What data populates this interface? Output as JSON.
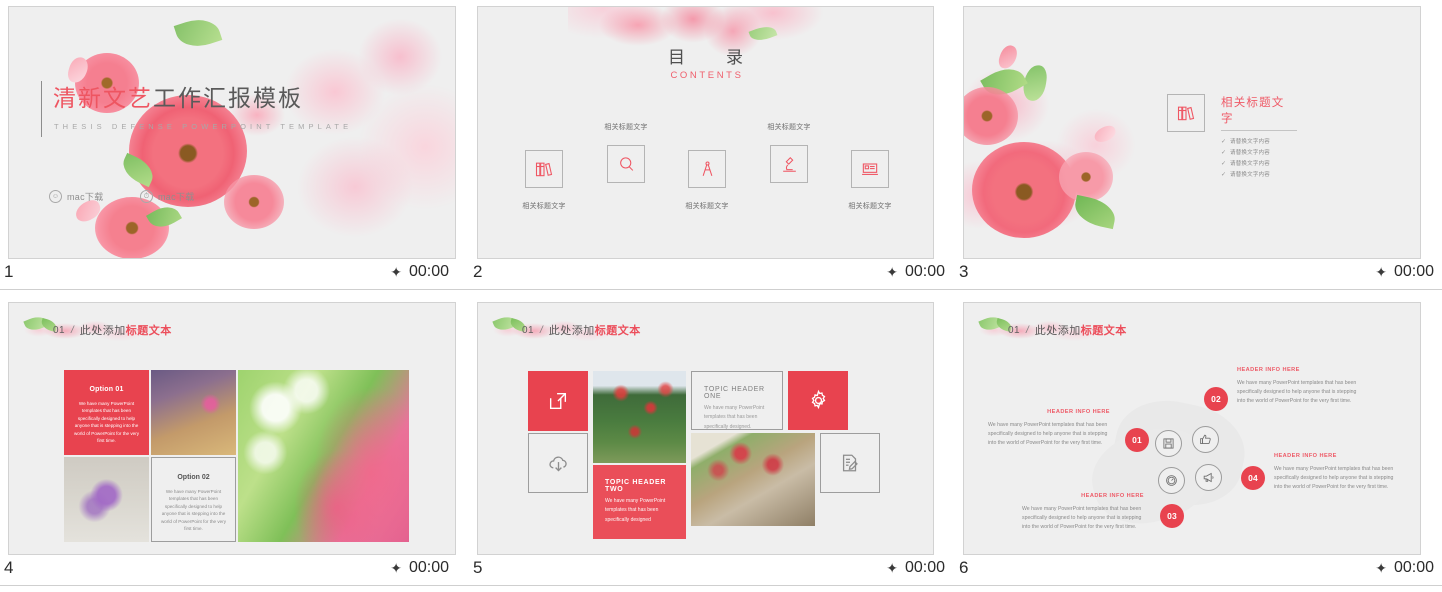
{
  "accent_red": "#e8434f",
  "title_red": "#ee5561",
  "slide_bg": "#efefef",
  "slides": [
    {
      "number": "1",
      "time": "00:00",
      "star_icon": "star-icon",
      "title_red_part": "清新文艺",
      "title_gray_part": "工作汇报模板",
      "subtitle": "THESIS DEFENSE POWERPOINT TEMPLATE",
      "downloads": [
        {
          "icon": "user-circle-icon",
          "glyph": "☺",
          "label": "mac下载"
        },
        {
          "icon": "clock-circle-icon",
          "glyph": "⏱",
          "label": "mac下载"
        }
      ]
    },
    {
      "number": "2",
      "time": "00:00",
      "star_icon": "star-icon",
      "heading_cn": "目　录",
      "heading_en": "CONTENTS",
      "items": [
        {
          "icon": "books-icon",
          "label": "相关标题文字",
          "pos": "bottom"
        },
        {
          "icon": "search-icon",
          "label": "相关标题文字",
          "pos": "top"
        },
        {
          "icon": "compass-icon",
          "label": "相关标题文字",
          "pos": "bottom"
        },
        {
          "icon": "microscope-icon",
          "label": "相关标题文字",
          "pos": "top"
        },
        {
          "icon": "laptop-icon",
          "label": "相关标题文字",
          "pos": "bottom"
        }
      ]
    },
    {
      "number": "3",
      "time": "00:00",
      "star_icon": "star-icon",
      "icon": "books-icon",
      "title": "相关标题文字",
      "bullets": [
        "请替换文字内容",
        "请替换文字内容",
        "请替换文字内容",
        "请替换文字内容"
      ],
      "check_glyph": "✓"
    },
    {
      "number": "4",
      "time": "00:00",
      "star_icon": "star-icon",
      "header": {
        "num": "01",
        "slash": "/",
        "text_gray": "此处添加",
        "text_red": "标题文本"
      },
      "option1": {
        "heading": "Option 01",
        "body": "We have many PowerPoint templates that has been specifically designed to help anyone that is stepping into the world of PowerPoint for the very first time."
      },
      "option2": {
        "heading": "Option 02",
        "body": "We have many PowerPoint templates that has been specifically designed to help anyone that is stepping into the world of PowerPoint for the very first time."
      },
      "photos": [
        "purple-cosmos-photo",
        "purple-flowers-photo",
        "pink-azalea-photo"
      ]
    },
    {
      "number": "5",
      "time": "00:00",
      "star_icon": "star-icon",
      "header": {
        "num": "01",
        "slash": "/",
        "text_gray": "此处添加",
        "text_red": "标题文本"
      },
      "tiles": [
        {
          "kind": "icon-red",
          "icon": "external-link-icon"
        },
        {
          "kind": "icon-outline",
          "icon": "cloud-download-icon"
        },
        {
          "kind": "icon-red",
          "icon": "gear-icon"
        },
        {
          "kind": "icon-outline",
          "icon": "edit-document-icon"
        }
      ],
      "topic_one": {
        "heading": "TOPIC HEADER ONE",
        "body": "We have many PowerPoint templates that has been specifically designed."
      },
      "topic_two": {
        "heading": "TOPIC HEADER TWO",
        "body": "We have many PowerPoint templates that has been specifically designed"
      },
      "photos": [
        "rose-bush-bicycle-photo",
        "blossom-road-photo"
      ]
    },
    {
      "number": "6",
      "time": "00:00",
      "star_icon": "star-icon",
      "header": {
        "num": "01",
        "slash": "/",
        "text_gray": "此处添加",
        "text_red": "标题文本"
      },
      "nodes": [
        {
          "badge": "01",
          "icon": "save-icon"
        },
        {
          "badge": "02",
          "icon": "thumbs-up-icon"
        },
        {
          "badge": "03",
          "icon": "gauge-icon"
        },
        {
          "badge": "04",
          "icon": "megaphone-icon"
        }
      ],
      "blocks": [
        {
          "heading": "HEADER INFO HERE",
          "body": "We have many PowerPoint templates that has been specifically designed to help anyone that is stepping into the world of PowerPoint for the very first time."
        },
        {
          "heading": "HEADER INFO HERE",
          "body": "We have many PowerPoint templates that has been specifically designed to help anyone that is stepping into the world of PowerPoint for the very first time."
        },
        {
          "heading": "HEADER INFO HERE",
          "body": "We have many PowerPoint templates that has been specifically designed to help anyone that is stepping into the world of PowerPoint for the very first time."
        },
        {
          "heading": "HEADER INFO HERE",
          "body": "We have many PowerPoint templates that has been specifically designed to help anyone that is stepping into the world of PowerPoint for the very first time."
        }
      ]
    }
  ]
}
